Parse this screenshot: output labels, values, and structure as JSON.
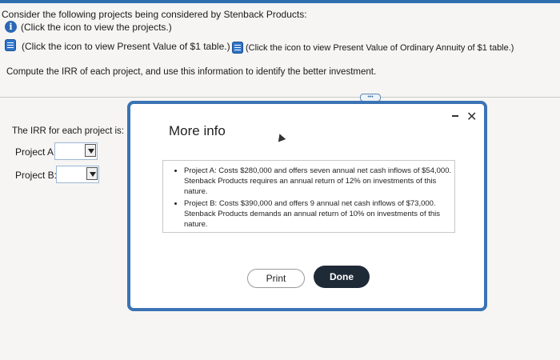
{
  "colors": {
    "accent": "#3a73b4",
    "done_button": "#1f2a37"
  },
  "header": {
    "question": "Consider the following projects being considered by Stenback Products:",
    "projects_link": "(Click the icon to view the projects.)",
    "pv1_link": "(Click the icon to view Present Value of $1 table.)",
    "pva_link": "(Click the icon to view Present Value of Ordinary Annuity of $1 table.)",
    "instruction": "Compute the IRR of each project, and use this information to identify the better investment."
  },
  "icons": {
    "info": "info-icon",
    "table": "table-icon"
  },
  "answer": {
    "heading": "The IRR for each project is:",
    "project_a_label": "Project A:",
    "project_b_label": "Project B:",
    "project_a_value": "",
    "project_b_value": ""
  },
  "modal": {
    "title": "More info",
    "minimize": "-",
    "close": "✕",
    "bullets": [
      "Project A: Costs $280,000 and offers seven annual net cash inflows of $54,000. Stenback Products requires an annual return of 12% on investments of this nature.",
      "Project B: Costs $390,000 and offers 9 annual net cash inflows of $73,000. Stenback Products demands an annual return of 10% on investments of this nature."
    ],
    "print_label": "Print",
    "done_label": "Done"
  }
}
